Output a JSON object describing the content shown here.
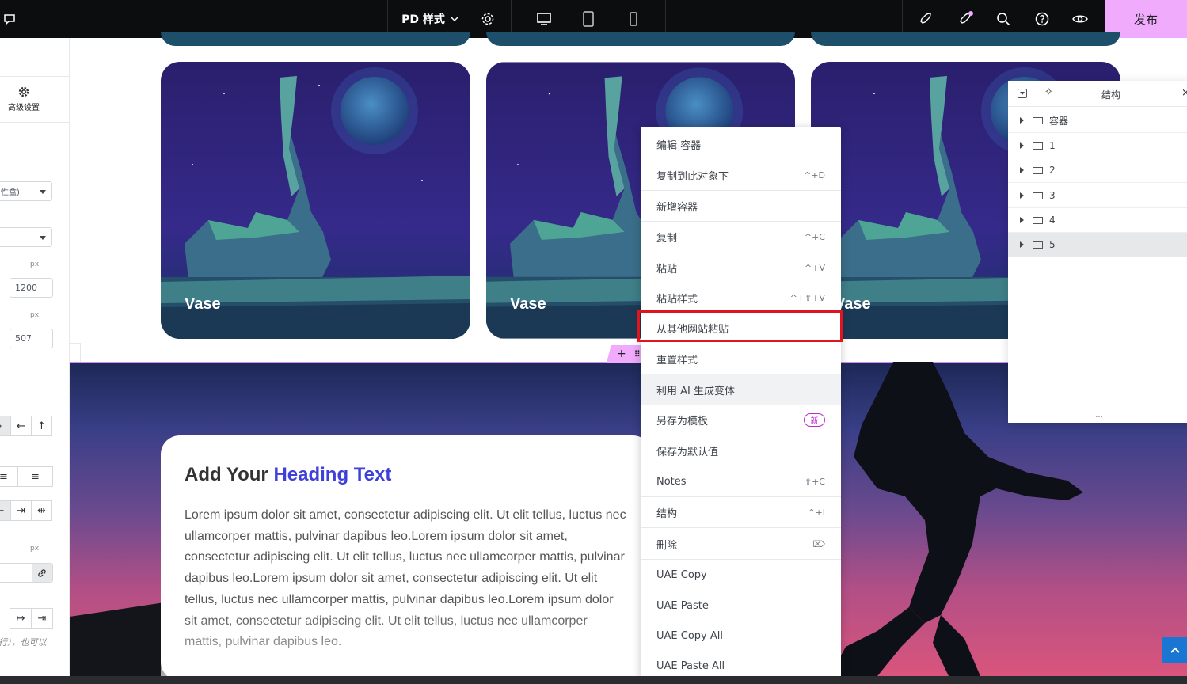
{
  "topbar": {
    "title": "PD 样式",
    "publish_label": "发布"
  },
  "left_panel": {
    "advanced_label": "高级设置",
    "select1_value": "性盒)",
    "unit1": "px",
    "width_value": "1200",
    "unit2": "px",
    "height_value": "507",
    "unit3": "px",
    "note": "行），也可以"
  },
  "cards": [
    {
      "label": "Vase"
    },
    {
      "label": "Vase"
    },
    {
      "label": "Vase"
    }
  ],
  "hero": {
    "heading_part1": "Add Your ",
    "heading_part2": "Heading Text",
    "paragraph": "Lorem ipsum dolor sit amet, consectetur adipiscing elit. Ut elit tellus, luctus nec ullamcorper mattis, pulvinar dapibus leo.Lorem ipsum dolor sit amet, consectetur adipiscing elit. Ut elit tellus, luctus nec ullamcorper mattis, pulvinar dapibus leo.Lorem ipsum dolor sit amet, consectetur adipiscing elit. Ut elit tellus, luctus nec ullamcorper mattis, pulvinar dapibus leo.Lorem ipsum dolor sit amet, consectetur adipiscing elit. Ut elit tellus, luctus nec ullamcorper mattis, pulvinar dapibus leo."
  },
  "context_menu": {
    "items": [
      {
        "label": "编辑 容器",
        "shortcut": ""
      },
      {
        "label": "复制到此对象下",
        "shortcut": "^+D"
      },
      {
        "label": "新增容器",
        "shortcut": ""
      },
      {
        "label": "复制",
        "shortcut": "^+C"
      },
      {
        "label": "粘贴",
        "shortcut": "^+V"
      },
      {
        "label": "粘贴样式",
        "shortcut": "^+⇧+V"
      },
      {
        "label": "从其他网站粘贴",
        "shortcut": ""
      },
      {
        "label": "重置样式",
        "shortcut": ""
      },
      {
        "label": "利用 AI 生成变体",
        "shortcut": ""
      },
      {
        "label": "另存为模板",
        "shortcut": "",
        "badge": "新"
      },
      {
        "label": "保存为默认值",
        "shortcut": ""
      },
      {
        "label": "Notes",
        "shortcut": "⇧+C"
      },
      {
        "label": "结构",
        "shortcut": "^+I"
      },
      {
        "label": "删除",
        "shortcut": "⌦"
      },
      {
        "label": "UAE Copy",
        "shortcut": ""
      },
      {
        "label": "UAE Paste",
        "shortcut": ""
      },
      {
        "label": "UAE Copy All",
        "shortcut": ""
      },
      {
        "label": "UAE Paste All",
        "shortcut": ""
      }
    ]
  },
  "navigator": {
    "title": "结构",
    "items": [
      {
        "label": "容器"
      },
      {
        "label": "1"
      },
      {
        "label": "2"
      },
      {
        "label": "3"
      },
      {
        "label": "4"
      },
      {
        "label": "5"
      }
    ]
  },
  "colors": {
    "accent": "#f0abfc",
    "heading_accent": "#3f3fd9",
    "highlight": "#e0141e"
  }
}
